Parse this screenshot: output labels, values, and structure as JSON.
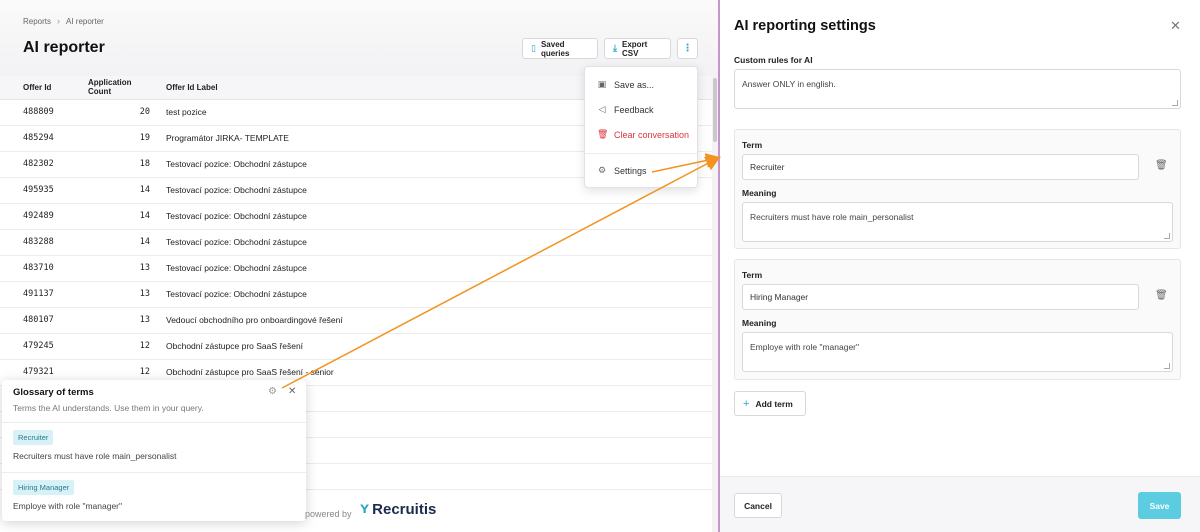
{
  "breadcrumb": {
    "root": "Reports",
    "current": "AI reporter"
  },
  "page": {
    "title": "AI reporter"
  },
  "toolbar": {
    "saved_queries": "Saved queries",
    "export_csv": "Export CSV",
    "more": "⋮"
  },
  "table": {
    "headers": [
      "Offer Id",
      "Application Count",
      "Offer Id Label"
    ],
    "rows": [
      [
        "488809",
        "20",
        "test pozice"
      ],
      [
        "485294",
        "19",
        "Programátor JIRKA- TEMPLATE"
      ],
      [
        "482302",
        "18",
        "Testovací pozice: Obchodní zástupce"
      ],
      [
        "495935",
        "14",
        "Testovací pozice: Obchodní zástupce"
      ],
      [
        "492489",
        "14",
        "Testovací pozice: Obchodní zástupce"
      ],
      [
        "483288",
        "14",
        "Testovací pozice: Obchodní zástupce"
      ],
      [
        "483710",
        "13",
        "Testovací pozice: Obchodní zástupce"
      ],
      [
        "491137",
        "13",
        "Testovací pozice: Obchodní zástupce"
      ],
      [
        "480107",
        "13",
        "Vedoucí obchodního pro onboardingové řešení"
      ],
      [
        "479245",
        "12",
        "Obchodní zástupce pro SaaS řešení"
      ],
      [
        "479321",
        "12",
        "Obchodní zástupce pro SaaS řešení - senior"
      ],
      [
        "",
        "",
        ""
      ],
      [
        "",
        "",
        ""
      ],
      [
        "",
        "",
        ""
      ],
      [
        "",
        "",
        ""
      ]
    ]
  },
  "menu": {
    "save_as": "Save as...",
    "feedback": "Feedback",
    "clear": "Clear conversation",
    "settings": "Settings"
  },
  "glossary": {
    "title": "Glossary of terms",
    "subtitle": "Terms the AI understands. Use them in your query.",
    "items": [
      {
        "term": "Recruiter",
        "meaning": "Recruiters must have role main_personalist"
      },
      {
        "term": "Hiring Manager",
        "meaning": "Employe with role \"manager\""
      }
    ]
  },
  "footer": {
    "powered": "powered by",
    "brand": "Recruitis"
  },
  "settings": {
    "title": "AI reporting settings",
    "custom_rules_label": "Custom rules for AI",
    "custom_rules_value": "Answer ONLY in english.",
    "term_label": "Term",
    "meaning_label": "Meaning",
    "terms": [
      {
        "term": "Recruiter",
        "meaning": "Recruiters must have role main_personalist"
      },
      {
        "term": "Hiring Manager",
        "meaning": "Employe with role \"manager\""
      }
    ],
    "add_term": "Add term",
    "cancel": "Cancel",
    "save": "Save"
  },
  "colors": {
    "accent": "#2aa7c8",
    "save": "#5ccde0",
    "danger": "#d9363e",
    "arrow": "#f29422"
  }
}
